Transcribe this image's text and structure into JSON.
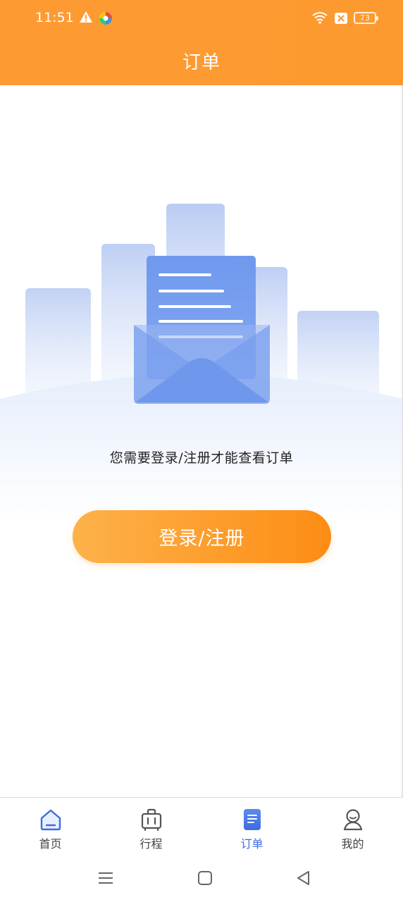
{
  "status_bar": {
    "time": "11:51",
    "battery": "73"
  },
  "header": {
    "title": "订单"
  },
  "main": {
    "message": "您需要登录/注册才能查看订单",
    "login_button": "登录/注册"
  },
  "tabbar": {
    "items": [
      {
        "label": "首页",
        "icon": "home-icon",
        "active": false
      },
      {
        "label": "行程",
        "icon": "luggage-icon",
        "active": false
      },
      {
        "label": "订单",
        "icon": "order-list-icon",
        "active": true
      },
      {
        "label": "我的",
        "icon": "user-icon",
        "active": false
      }
    ]
  },
  "colors": {
    "header": "#fe9a32",
    "accent": "#3d6ce0",
    "button_start": "#fdb24a",
    "button_end": "#fd8c14"
  }
}
